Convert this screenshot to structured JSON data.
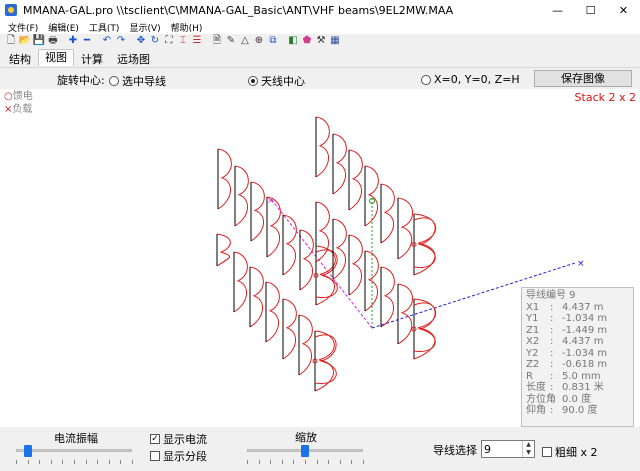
{
  "window": {
    "title": "MMANA-GAL.pro \\\\tsclient\\C\\MMANA-GAL_Basic\\ANT\\VHF beams\\9EL2MW.MAA",
    "minimize": "—",
    "maximize": "☐",
    "close": "✕"
  },
  "menu": [
    "文件(F)",
    "编辑(E)",
    "工具(T)",
    "显示(V)",
    "帮助(H)"
  ],
  "toolbar": [
    {
      "name": "new-file-icon",
      "glyph": "🗋",
      "color": "#333333"
    },
    {
      "name": "open-folder-icon",
      "glyph": "📂",
      "color": "#c9a227"
    },
    {
      "name": "save-icon",
      "glyph": "💾",
      "color": "#2a4f9e"
    },
    {
      "name": "print-icon",
      "glyph": "🖶",
      "color": "#444444"
    },
    {
      "name": "add-icon",
      "glyph": "✚",
      "color": "#1a56c9"
    },
    {
      "name": "remove-icon",
      "glyph": "━",
      "color": "#1a56c9"
    },
    {
      "name": "undo-icon",
      "glyph": "↶",
      "color": "#1a56c9"
    },
    {
      "name": "redo-icon",
      "glyph": "↷",
      "color": "#1a56c9"
    },
    {
      "name": "move-icon",
      "glyph": "✥",
      "color": "#1a56c9"
    },
    {
      "name": "rotate-icon",
      "glyph": "↻",
      "color": "#1a56c9"
    },
    {
      "name": "resize-icon",
      "glyph": "⛶",
      "color": "#333333"
    },
    {
      "name": "segment-icon",
      "glyph": "⌶",
      "color": "#c03030"
    },
    {
      "name": "wire-list-icon",
      "glyph": "☰",
      "color": "#c03030"
    },
    {
      "name": "document-icon",
      "glyph": "🗎",
      "color": "#444444"
    },
    {
      "name": "edit-icon",
      "glyph": "✎",
      "color": "#444444"
    },
    {
      "name": "triangle-icon",
      "glyph": "△",
      "color": "#333333"
    },
    {
      "name": "target-icon",
      "glyph": "⊕",
      "color": "#333333"
    },
    {
      "name": "copy-icon",
      "glyph": "⧉",
      "color": "#1a56c9"
    },
    {
      "name": "shape-icon",
      "glyph": "◧",
      "color": "#2a7a2a"
    },
    {
      "name": "color-icon",
      "glyph": "⬟",
      "color": "#d04090"
    },
    {
      "name": "tools-icon",
      "glyph": "⚒",
      "color": "#333333"
    },
    {
      "name": "calculator-icon",
      "glyph": "▦",
      "color": "#2a4f9e"
    }
  ],
  "tabs": [
    "结构",
    "视图",
    "计算",
    "远场图"
  ],
  "active_tab": 1,
  "options": {
    "rotation_label": "旋转中心:",
    "radio_selected_wire": "选中导线",
    "radio_antenna_center": "天线中心",
    "radio_origin": "X=0, Y=0, Z=H",
    "selected_radio": "antenna_center",
    "save_image": "保存图像"
  },
  "legend": {
    "feed_marker": "○",
    "feed_label": "馈电",
    "load_marker": "×",
    "load_label": "负载"
  },
  "stack_label": "Stack 2 x 2",
  "colors": {
    "wire": "#000000",
    "current": "#e02020",
    "axis_x": "#2020e0",
    "axis_y": "#e020e0",
    "axis_z": "#20a020",
    "stack_text": "#e01010"
  },
  "wire_info": {
    "title": "导线编号 9",
    "rows": [
      {
        "k": "X1",
        "v": "4.437 m"
      },
      {
        "k": "Y1",
        "v": "-1.034 m"
      },
      {
        "k": "Z1",
        "v": "-1.449 m"
      },
      {
        "k": "X2",
        "v": "4.437 m"
      },
      {
        "k": "Y2",
        "v": "-1.034 m"
      },
      {
        "k": "Z2",
        "v": "-0.618 m"
      },
      {
        "k": "R",
        "v": "5.0 mm"
      },
      {
        "k": "长度",
        "v": "0.831 米"
      },
      {
        "k": "方位角",
        "v": "0.0 度"
      },
      {
        "k": "仰角",
        "v": "90.0 度"
      }
    ]
  },
  "bottom": {
    "current_amplitude": "电流振幅",
    "show_current": "显示电流",
    "show_current_checked": true,
    "show_segments": "显示分段",
    "show_segments_checked": false,
    "zoom": "缩放",
    "wire_select_label": "导线选择",
    "wire_select_value": "9",
    "bold_x2": "粗细 x 2",
    "bold_checked": false,
    "current_amplitude_level": 0.1,
    "zoom_level": 0.5
  }
}
